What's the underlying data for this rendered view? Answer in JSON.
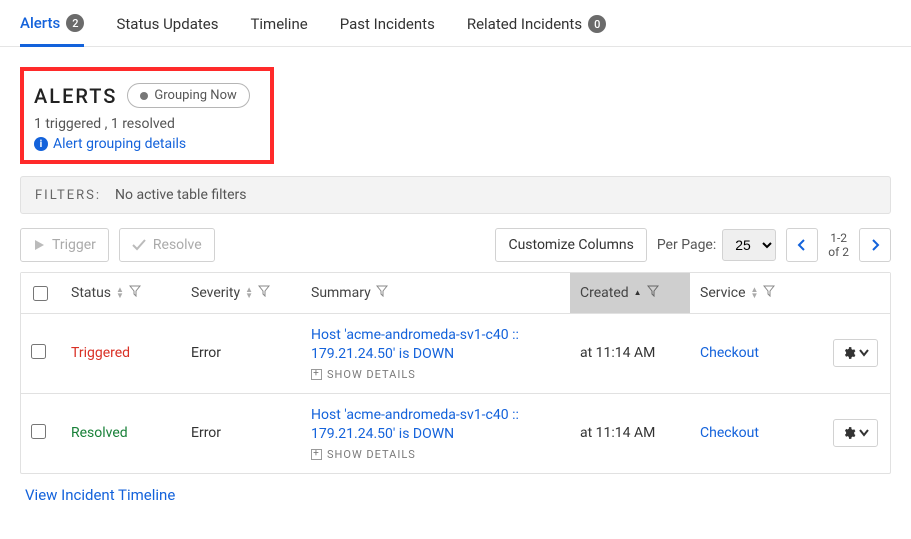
{
  "tabs": {
    "alerts": {
      "label": "Alerts",
      "count": "2"
    },
    "status_updates": {
      "label": "Status Updates"
    },
    "timeline": {
      "label": "Timeline"
    },
    "past_incidents": {
      "label": "Past Incidents"
    },
    "related_incidents": {
      "label": "Related Incidents",
      "count": "0"
    }
  },
  "header": {
    "title": "ALERTS",
    "pill": "Grouping Now",
    "subtext": "1 triggered , 1 resolved",
    "details_link": "Alert grouping details"
  },
  "filters": {
    "label": "FILTERS:",
    "text": "No active table filters"
  },
  "toolbar": {
    "trigger": "Trigger",
    "resolve": "Resolve",
    "customize": "Customize Columns",
    "per_page_label": "Per Page:",
    "per_page_value": "25",
    "range_top": "1-2",
    "range_bottom": "of 2"
  },
  "columns": {
    "status": "Status",
    "severity": "Severity",
    "summary": "Summary",
    "created": "Created",
    "service": "Service"
  },
  "rows": [
    {
      "status": "Triggered",
      "status_class": "triggered",
      "severity": "Error",
      "summary": "Host 'acme-andromeda-sv1-c40 :: 179.21.24.50' is DOWN",
      "show_details": "SHOW DETAILS",
      "created": "at 11:14 AM",
      "service": "Checkout"
    },
    {
      "status": "Resolved",
      "status_class": "resolved",
      "severity": "Error",
      "summary": "Host 'acme-andromeda-sv1-c40 :: 179.21.24.50' is DOWN",
      "show_details": "SHOW DETAILS",
      "created": "at 11:14 AM",
      "service": "Checkout"
    }
  ],
  "footer": {
    "timeline_link": "View Incident Timeline"
  }
}
